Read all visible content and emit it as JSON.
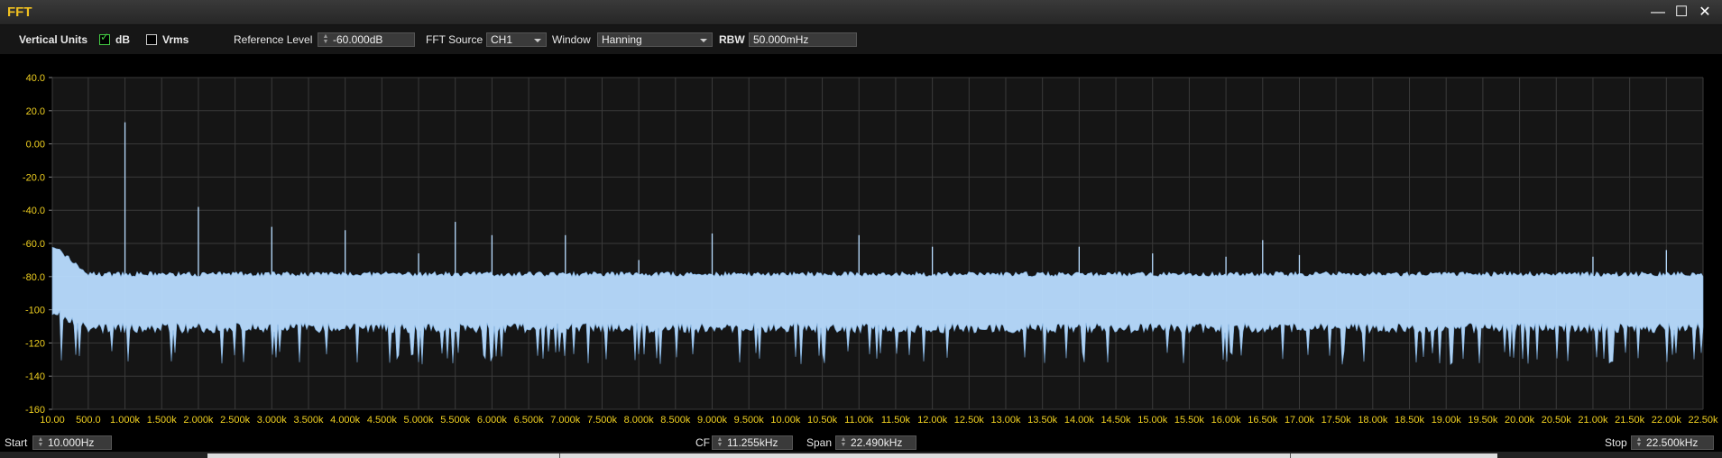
{
  "window": {
    "title": "FFT",
    "minimize_glyph": "—",
    "maximize_glyph": "☐",
    "close_glyph": "✕"
  },
  "toolbar": {
    "vertical_units_label": "Vertical Units",
    "db_label": "dB",
    "db_checked": true,
    "vrms_label": "Vrms",
    "vrms_checked": false,
    "reference_level_label": "Reference Level",
    "reference_level_value": "-60.000dB",
    "fft_source_label": "FFT Source",
    "fft_source_value": "CH1",
    "window_label": "Window",
    "window_value": "Hanning",
    "rbw_label": "RBW",
    "rbw_value": "50.000mHz"
  },
  "footer": {
    "start_label": "Start",
    "start_value": "10.000Hz",
    "cf_label": "CF",
    "cf_value": "11.255kHz",
    "span_label": "Span",
    "span_value": "22.490kHz",
    "stop_label": "Stop",
    "stop_value": "22.500kHz"
  },
  "colors": {
    "axis_label": "#f0d020",
    "trace": "#b8dcff",
    "trace_dark": "#7fb0e0",
    "grid": "#3a3a3a",
    "plot_bg": "#151515"
  },
  "chart_data": {
    "type": "line",
    "title": "",
    "xlabel": "",
    "ylabel": "",
    "ylim": [
      -160,
      40
    ],
    "xlim": [
      10,
      22500
    ],
    "y_ticks": [
      "40.0",
      "20.0",
      "0.00",
      "-20.0",
      "-40.0",
      "-60.0",
      "-80.0",
      "-100",
      "-120",
      "-140",
      "-160"
    ],
    "y_tick_values": [
      40,
      20,
      0,
      -20,
      -40,
      -60,
      -80,
      -100,
      -120,
      -140,
      -160
    ],
    "x_ticks": [
      "10.00",
      "500.0",
      "1.000k",
      "1.500k",
      "2.000k",
      "2.500k",
      "3.000k",
      "3.500k",
      "4.000k",
      "4.500k",
      "5.000k",
      "5.500k",
      "6.000k",
      "6.500k",
      "7.000k",
      "7.500k",
      "8.000k",
      "8.500k",
      "9.000k",
      "9.500k",
      "10.00k",
      "10.50k",
      "11.00k",
      "11.50k",
      "12.00k",
      "12.50k",
      "13.00k",
      "13.50k",
      "14.00k",
      "14.50k",
      "15.00k",
      "15.50k",
      "16.00k",
      "16.50k",
      "17.00k",
      "17.50k",
      "18.00k",
      "18.50k",
      "19.00k",
      "19.50k",
      "20.00k",
      "20.50k",
      "21.00k",
      "21.50k",
      "22.00k",
      "22.50k"
    ],
    "x_tick_values": [
      10,
      500,
      1000,
      1500,
      2000,
      2500,
      3000,
      3500,
      4000,
      4500,
      5000,
      5500,
      6000,
      6500,
      7000,
      7500,
      8000,
      8500,
      9000,
      9500,
      10000,
      10500,
      11000,
      11500,
      12000,
      12500,
      13000,
      13500,
      14000,
      14500,
      15000,
      15500,
      16000,
      16500,
      17000,
      17500,
      18000,
      18500,
      19000,
      19500,
      20000,
      20500,
      21000,
      21500,
      22000,
      22500
    ],
    "noise_floor_db": {
      "top": -80,
      "bottom": -108,
      "low_spikes_to": -125
    },
    "series": [
      {
        "peaks": [
          {
            "x": 1000,
            "y": 13
          },
          {
            "x": 2000,
            "y": -38
          },
          {
            "x": 3000,
            "y": -50
          },
          {
            "x": 4000,
            "y": -52
          },
          {
            "x": 5000,
            "y": -66
          },
          {
            "x": 5500,
            "y": -47
          },
          {
            "x": 6000,
            "y": -55
          },
          {
            "x": 7000,
            "y": -55
          },
          {
            "x": 8000,
            "y": -70
          },
          {
            "x": 9000,
            "y": -54
          },
          {
            "x": 11000,
            "y": -55
          },
          {
            "x": 12000,
            "y": -62
          },
          {
            "x": 14000,
            "y": -62
          },
          {
            "x": 15000,
            "y": -66
          },
          {
            "x": 16000,
            "y": -68
          },
          {
            "x": 16500,
            "y": -58
          },
          {
            "x": 17000,
            "y": -67
          },
          {
            "x": 21000,
            "y": -68
          },
          {
            "x": 22000,
            "y": -64
          }
        ]
      }
    ]
  }
}
